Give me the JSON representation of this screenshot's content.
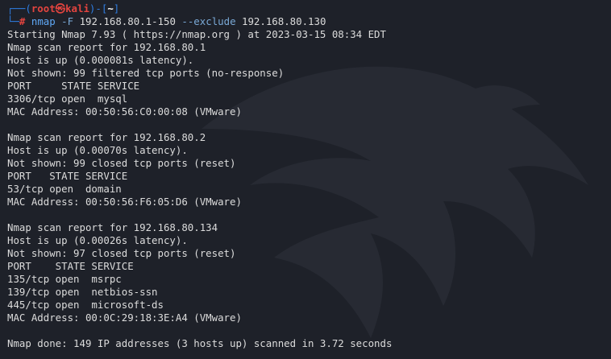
{
  "prompt": {
    "frame_open": "┌──(",
    "user_host": "root㉿kali",
    "frame_mid": ")-[",
    "dir": "~",
    "frame_close": "]",
    "frame_bottom": "└─",
    "symbol": "#"
  },
  "command": {
    "program": "nmap",
    "flag1": "-F",
    "arg1": "192.168.80.1-150",
    "flag2": "--exclude",
    "arg2": "192.168.80.130"
  },
  "output_lines": [
    "Starting Nmap 7.93 ( https://nmap.org ) at 2023-03-15 08:34 EDT",
    "Nmap scan report for 192.168.80.1",
    "Host is up (0.000081s latency).",
    "Not shown: 99 filtered tcp ports (no-response)",
    "PORT     STATE SERVICE",
    "3306/tcp open  mysql",
    "MAC Address: 00:50:56:C0:00:08 (VMware)",
    "",
    "Nmap scan report for 192.168.80.2",
    "Host is up (0.00070s latency).",
    "Not shown: 99 closed tcp ports (reset)",
    "PORT   STATE SERVICE",
    "53/tcp open  domain",
    "MAC Address: 00:50:56:F6:05:D6 (VMware)",
    "",
    "Nmap scan report for 192.168.80.134",
    "Host is up (0.00026s latency).",
    "Not shown: 97 closed tcp ports (reset)",
    "PORT    STATE SERVICE",
    "135/tcp open  msrpc",
    "139/tcp open  netbios-ssn",
    "445/tcp open  microsoft-ds",
    "MAC Address: 00:0C:29:18:3E:A4 (VMware)",
    "",
    "Nmap done: 149 IP addresses (3 hosts up) scanned in 3.72 seconds"
  ],
  "colors": {
    "background": "#1e2129",
    "prompt_frame": "#2f7de1",
    "prompt_user": "#e3443f",
    "command": "#5fa8f5",
    "text": "#dcdcdc"
  },
  "watermark": "kali-dragon-logo"
}
